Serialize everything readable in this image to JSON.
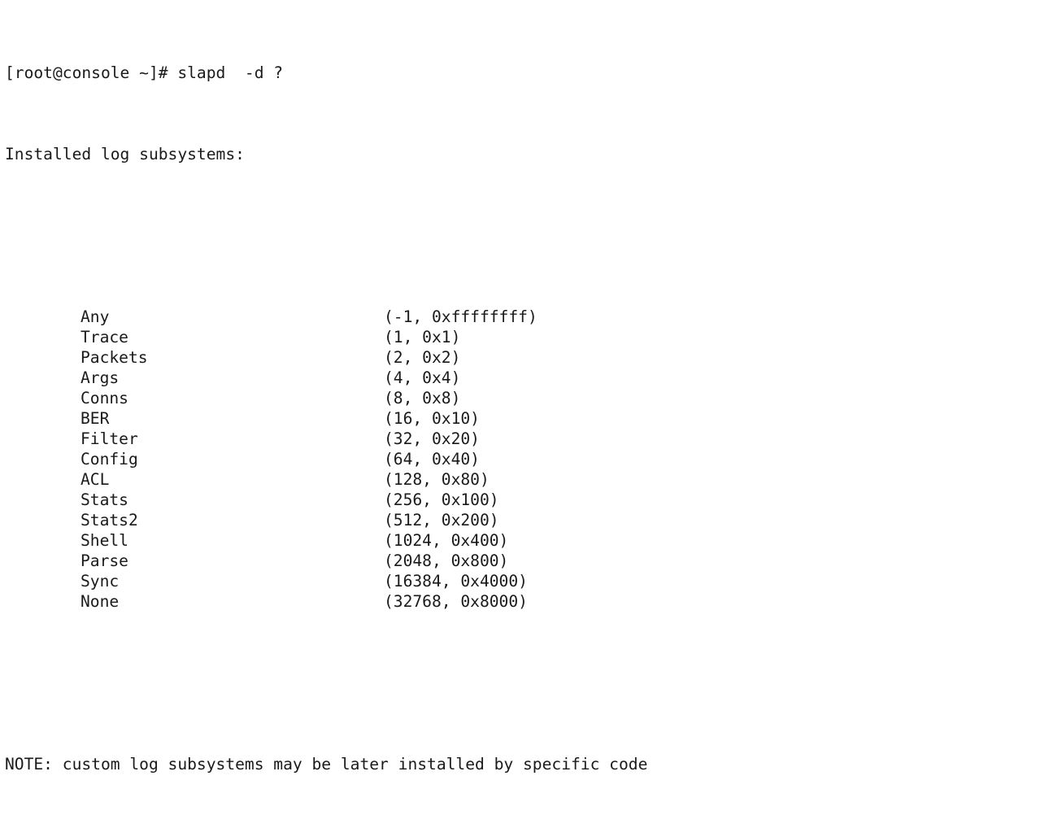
{
  "terminal": {
    "prompt": "[root@console ~]#",
    "command": " slapd  -d ?",
    "header": "Installed log subsystems:",
    "note": "NOTE: custom log subsystems may be later installed by specific code",
    "colors": {
      "background": "#ffffff",
      "foreground": "#1a1a1a"
    },
    "subsystems": [
      {
        "name": "Any",
        "value": "(-1, 0xffffffff)",
        "decimal": "-1",
        "hex": "0xffffffff"
      },
      {
        "name": "Trace",
        "value": "(1, 0x1)",
        "decimal": "1",
        "hex": "0x1"
      },
      {
        "name": "Packets",
        "value": "(2, 0x2)",
        "decimal": "2",
        "hex": "0x2"
      },
      {
        "name": "Args",
        "value": "(4, 0x4)",
        "decimal": "4",
        "hex": "0x4"
      },
      {
        "name": "Conns",
        "value": "(8, 0x8)",
        "decimal": "8",
        "hex": "0x8"
      },
      {
        "name": "BER",
        "value": "(16, 0x10)",
        "decimal": "16",
        "hex": "0x10"
      },
      {
        "name": "Filter",
        "value": "(32, 0x20)",
        "decimal": "32",
        "hex": "0x20"
      },
      {
        "name": "Config",
        "value": "(64, 0x40)",
        "decimal": "64",
        "hex": "0x40"
      },
      {
        "name": "ACL",
        "value": "(128, 0x80)",
        "decimal": "128",
        "hex": "0x80"
      },
      {
        "name": "Stats",
        "value": "(256, 0x100)",
        "decimal": "256",
        "hex": "0x100"
      },
      {
        "name": "Stats2",
        "value": "(512, 0x200)",
        "decimal": "512",
        "hex": "0x200"
      },
      {
        "name": "Shell",
        "value": "(1024, 0x400)",
        "decimal": "1024",
        "hex": "0x400"
      },
      {
        "name": "Parse",
        "value": "(2048, 0x800)",
        "decimal": "2048",
        "hex": "0x800"
      },
      {
        "name": "Sync",
        "value": "(16384, 0x4000)",
        "decimal": "16384",
        "hex": "0x4000"
      },
      {
        "name": "None",
        "value": "(32768, 0x8000)",
        "decimal": "32768",
        "hex": "0x8000"
      }
    ]
  }
}
